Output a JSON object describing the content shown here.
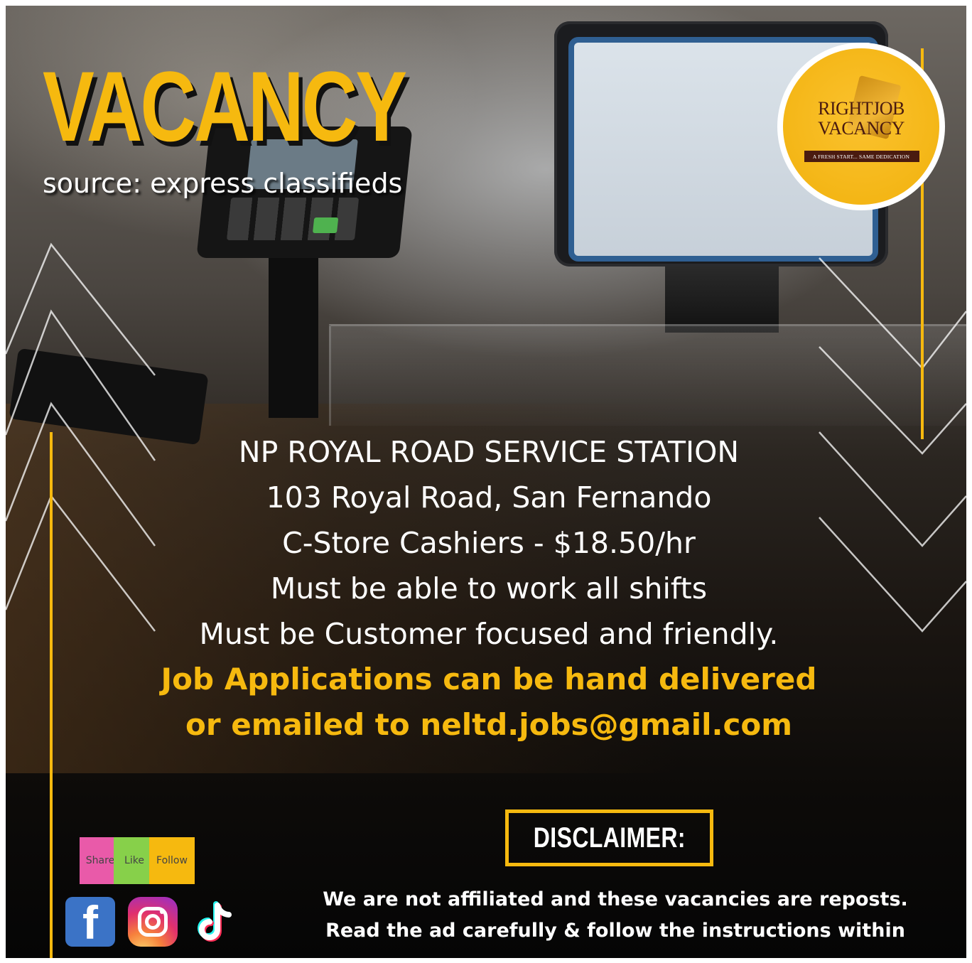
{
  "header": {
    "title": "VACANCY",
    "source": "source: express classifieds"
  },
  "logo": {
    "line1": "RIGHTJOB",
    "line2": "VACANCY",
    "tagline": "A FRESH START... SAME DEDICATION"
  },
  "job": {
    "company": "NP ROYAL ROAD SERVICE STATION",
    "address": "103 Royal Road, San Fernando",
    "position": "C-Store Cashiers - $18.50/hr",
    "requirement_1": "Must be able to work all shifts",
    "requirement_2": "Must be Customer focused and friendly.",
    "apply_line_1": "Job Applications can be hand delivered",
    "apply_line_2": "or emailed to neltd.jobs@gmail.com"
  },
  "disclaimer": {
    "label": "DISCLAIMER:",
    "line_1": "We are not affiliated and these vacancies are reposts.",
    "line_2": "Read the ad carefully & follow the instructions within"
  },
  "social": {
    "share": "Share",
    "like": "Like",
    "follow": "Follow",
    "icons": [
      "facebook-icon",
      "instagram-icon",
      "tiktok-icon"
    ]
  },
  "colors": {
    "accent": "#f6b90f",
    "text": "#ffffff",
    "logo_text": "#4a1b10",
    "facebook": "#3b73c6",
    "share_tag": "#e95aa9",
    "like_tag": "#87d04a"
  }
}
